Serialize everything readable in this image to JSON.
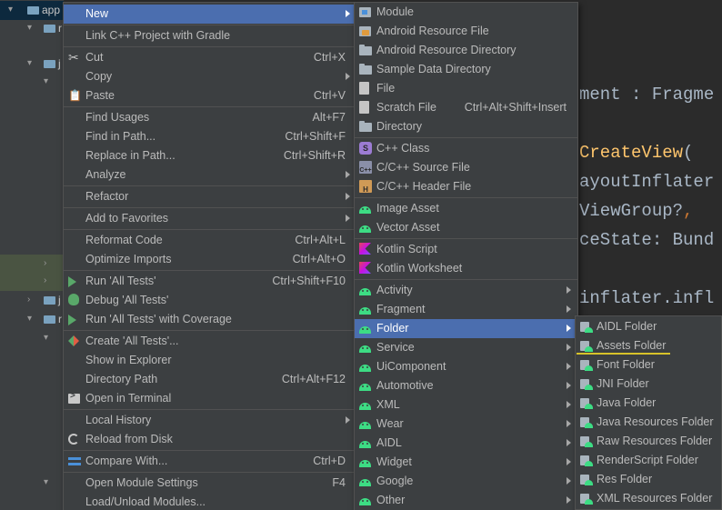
{
  "project_tree": {
    "root_label": "app",
    "rows": [
      {
        "label": "r"
      },
      {
        "label": "j"
      },
      {
        "label": "j"
      },
      {
        "label": "r"
      }
    ]
  },
  "editor": {
    "lines": [
      {
        "text": "ment : Fragme"
      },
      {
        "prefix": "",
        "fn": "CreateView",
        "suffix": "("
      },
      {
        "text": "ayoutInflater"
      },
      {
        "text": "ViewGroup?",
        "kw": ","
      },
      {
        "text": "ceState: Bund"
      },
      {
        "text": "inflater.infl"
      }
    ]
  },
  "context_menu": {
    "items": [
      {
        "label": "New",
        "submenu": true,
        "active": true
      },
      {
        "sep": true
      },
      {
        "label": "Link C++ Project with Gradle"
      },
      {
        "sep": true
      },
      {
        "label": "Cut",
        "icon": "scissors-icon",
        "shortcut": "Ctrl+X"
      },
      {
        "label": "Copy",
        "submenu": true
      },
      {
        "label": "Paste",
        "icon": "clipboard-icon",
        "shortcut": "Ctrl+V"
      },
      {
        "sep": true
      },
      {
        "label": "Find Usages",
        "shortcut": "Alt+F7"
      },
      {
        "label": "Find in Path...",
        "shortcut": "Ctrl+Shift+F"
      },
      {
        "label": "Replace in Path...",
        "shortcut": "Ctrl+Shift+R"
      },
      {
        "label": "Analyze",
        "submenu": true
      },
      {
        "sep": true
      },
      {
        "label": "Refactor",
        "submenu": true
      },
      {
        "sep": true
      },
      {
        "label": "Add to Favorites",
        "submenu": true
      },
      {
        "sep": true
      },
      {
        "label": "Reformat Code",
        "shortcut": "Ctrl+Alt+L"
      },
      {
        "label": "Optimize Imports",
        "shortcut": "Ctrl+Alt+O"
      },
      {
        "sep": true
      },
      {
        "label": "Run 'All Tests'",
        "icon": "run-icon",
        "shortcut": "Ctrl+Shift+F10"
      },
      {
        "label": "Debug 'All Tests'",
        "icon": "debug-icon"
      },
      {
        "label": "Run 'All Tests' with Coverage",
        "icon": "coverage-icon"
      },
      {
        "sep": true
      },
      {
        "label": "Create 'All Tests'...",
        "icon": "create-test-icon"
      },
      {
        "label": "Show in Explorer"
      },
      {
        "label": "Directory Path",
        "shortcut": "Ctrl+Alt+F12"
      },
      {
        "label": "Open in Terminal",
        "icon": "terminal-icon"
      },
      {
        "sep": true
      },
      {
        "label": "Local History",
        "submenu": true
      },
      {
        "label": "Reload from Disk",
        "icon": "reload-icon"
      },
      {
        "sep": true
      },
      {
        "label": "Compare With...",
        "icon": "compare-icon",
        "shortcut": "Ctrl+D"
      },
      {
        "sep": true
      },
      {
        "label": "Open Module Settings",
        "shortcut": "F4"
      },
      {
        "label": "Load/Unload Modules..."
      }
    ]
  },
  "new_menu": {
    "items": [
      {
        "label": "Module",
        "icon": "module-icon"
      },
      {
        "label": "Android Resource File",
        "icon": "resource-file-icon"
      },
      {
        "label": "Android Resource Directory",
        "icon": "folder-icon"
      },
      {
        "label": "Sample Data Directory",
        "icon": "folder-icon"
      },
      {
        "label": "File",
        "icon": "file-icon"
      },
      {
        "label": "Scratch File",
        "icon": "scratch-file-icon",
        "shortcut": "Ctrl+Alt+Shift+Insert"
      },
      {
        "label": "Directory",
        "icon": "folder-icon"
      },
      {
        "sep": true
      },
      {
        "label": "C++ Class",
        "icon": "cpp-class-icon"
      },
      {
        "label": "C/C++ Source File",
        "icon": "cpp-source-icon"
      },
      {
        "label": "C/C++ Header File",
        "icon": "cpp-header-icon"
      },
      {
        "sep": true
      },
      {
        "label": "Image Asset",
        "icon": "android-icon"
      },
      {
        "label": "Vector Asset",
        "icon": "android-icon"
      },
      {
        "sep": true
      },
      {
        "label": "Kotlin Script",
        "icon": "kotlin-icon"
      },
      {
        "label": "Kotlin Worksheet",
        "icon": "kotlin-icon"
      },
      {
        "sep": true
      },
      {
        "label": "Activity",
        "icon": "android-icon",
        "submenu": true
      },
      {
        "label": "Fragment",
        "icon": "android-icon",
        "submenu": true
      },
      {
        "label": "Folder",
        "icon": "android-icon",
        "submenu": true,
        "active": true
      },
      {
        "label": "Service",
        "icon": "android-icon",
        "submenu": true
      },
      {
        "label": "UiComponent",
        "icon": "android-icon",
        "submenu": true
      },
      {
        "label": "Automotive",
        "icon": "android-icon",
        "submenu": true
      },
      {
        "label": "XML",
        "icon": "android-icon",
        "submenu": true
      },
      {
        "label": "Wear",
        "icon": "android-icon",
        "submenu": true
      },
      {
        "label": "AIDL",
        "icon": "android-icon",
        "submenu": true
      },
      {
        "label": "Widget",
        "icon": "android-icon",
        "submenu": true
      },
      {
        "label": "Google",
        "icon": "android-icon",
        "submenu": true
      },
      {
        "label": "Other",
        "icon": "android-icon",
        "submenu": true
      }
    ]
  },
  "folder_menu": {
    "items": [
      {
        "label": "AIDL Folder"
      },
      {
        "label": "Assets Folder"
      },
      {
        "label": "Font Folder"
      },
      {
        "label": "JNI Folder"
      },
      {
        "label": "Java Folder"
      },
      {
        "label": "Java Resources Folder"
      },
      {
        "label": "Raw Resources Folder"
      },
      {
        "label": "RenderScript Folder"
      },
      {
        "label": "Res Folder"
      },
      {
        "label": "XML Resources Folder"
      }
    ]
  },
  "colors": {
    "menu_bg": "#3c3f41",
    "selection": "#4b6eaf",
    "android_green": "#3ddc84",
    "highlight_underline": "#d8c22a"
  }
}
